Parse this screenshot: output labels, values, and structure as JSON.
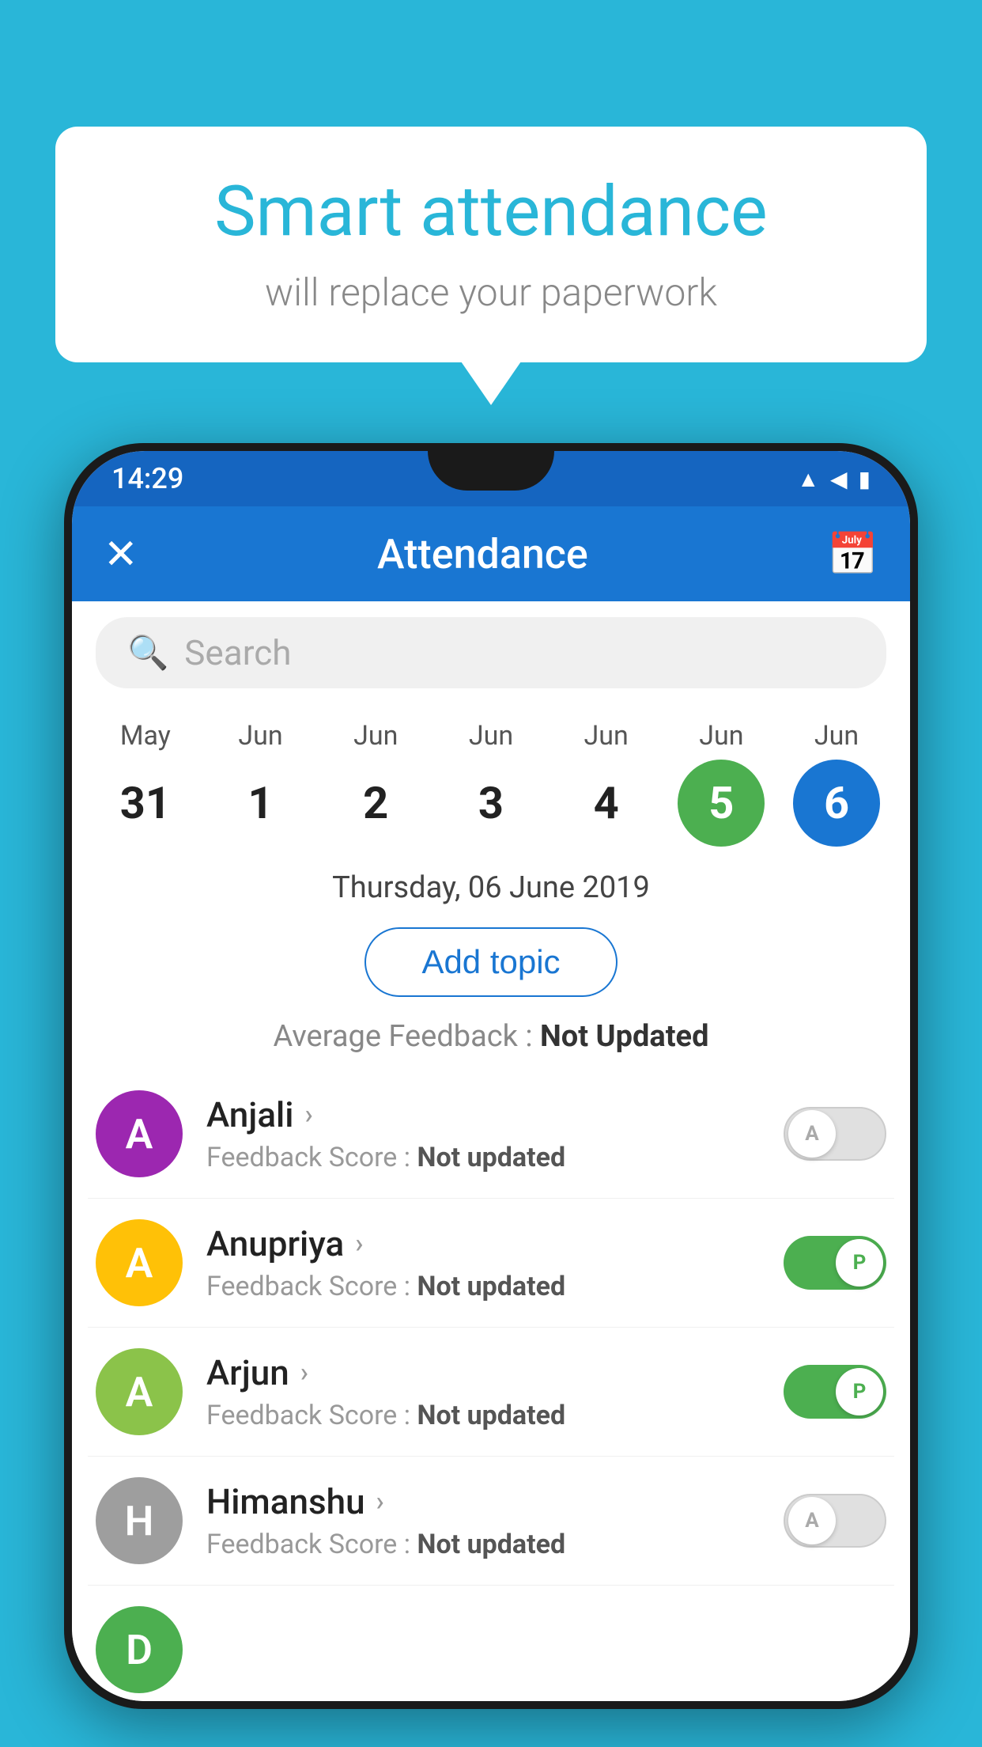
{
  "background_color": "#29B6D8",
  "speech_bubble": {
    "title": "Smart attendance",
    "subtitle": "will replace your paperwork"
  },
  "status_bar": {
    "time": "14:29",
    "icons": [
      "wifi",
      "signal",
      "battery"
    ]
  },
  "app_bar": {
    "title": "Attendance",
    "close_label": "✕",
    "calendar_label": "📅"
  },
  "search": {
    "placeholder": "Search"
  },
  "calendar": {
    "days": [
      {
        "month": "May",
        "date": "31",
        "style": "normal"
      },
      {
        "month": "Jun",
        "date": "1",
        "style": "normal"
      },
      {
        "month": "Jun",
        "date": "2",
        "style": "normal"
      },
      {
        "month": "Jun",
        "date": "3",
        "style": "normal"
      },
      {
        "month": "Jun",
        "date": "4",
        "style": "normal"
      },
      {
        "month": "Jun",
        "date": "5",
        "style": "today"
      },
      {
        "month": "Jun",
        "date": "6",
        "style": "selected"
      }
    ]
  },
  "selected_date_label": "Thursday, 06 June 2019",
  "add_topic_label": "Add topic",
  "average_feedback_label": "Average Feedback :",
  "average_feedback_value": "Not Updated",
  "students": [
    {
      "name": "Anjali",
      "initial": "A",
      "avatar_color": "#9C27B0",
      "feedback_label": "Feedback Score :",
      "feedback_value": "Not updated",
      "toggle_state": "off",
      "toggle_letter": "A"
    },
    {
      "name": "Anupriya",
      "initial": "A",
      "avatar_color": "#FFC107",
      "feedback_label": "Feedback Score :",
      "feedback_value": "Not updated",
      "toggle_state": "on",
      "toggle_letter": "P"
    },
    {
      "name": "Arjun",
      "initial": "A",
      "avatar_color": "#8BC34A",
      "feedback_label": "Feedback Score :",
      "feedback_value": "Not updated",
      "toggle_state": "on",
      "toggle_letter": "P"
    },
    {
      "name": "Himanshu",
      "initial": "H",
      "avatar_color": "#9E9E9E",
      "feedback_label": "Feedback Score :",
      "feedback_value": "Not updated",
      "toggle_state": "off",
      "toggle_letter": "A"
    }
  ],
  "partial_student": {
    "initial": "D",
    "avatar_color": "#4CAF50"
  }
}
